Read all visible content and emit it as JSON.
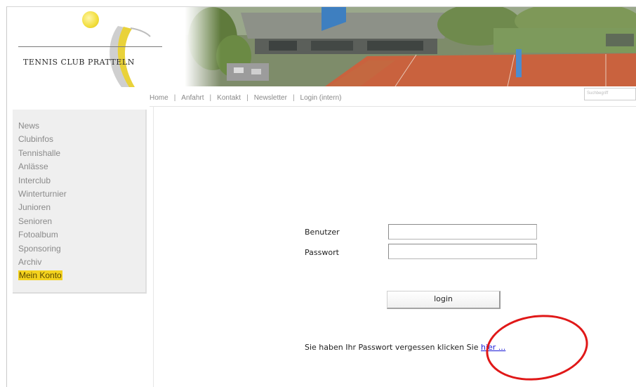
{
  "header": {
    "logo_text": "TENNIS CLUB PRATTELN"
  },
  "topnav": {
    "items": [
      {
        "label": "Home"
      },
      {
        "label": "Anfahrt"
      },
      {
        "label": "Kontakt"
      },
      {
        "label": "Newsletter"
      },
      {
        "label": "Login (intern)"
      }
    ],
    "search_placeholder": "Suchbegriff"
  },
  "sidebar": {
    "items": [
      {
        "label": "News"
      },
      {
        "label": "Clubinfos"
      },
      {
        "label": "Tennishalle"
      },
      {
        "label": "Anlässe"
      },
      {
        "label": "Interclub"
      },
      {
        "label": "Winterturnier"
      },
      {
        "label": "Junioren"
      },
      {
        "label": "Senioren"
      },
      {
        "label": "Fotoalbum"
      },
      {
        "label": "Sponsoring"
      },
      {
        "label": "Archiv"
      },
      {
        "label": "Mein Konto"
      }
    ],
    "active_color": "#f4d21e"
  },
  "login": {
    "username_label": "Benutzer",
    "password_label": "Passwort",
    "username_value": "",
    "password_value": "",
    "button_label": "login",
    "forgot_text": "Sie haben Ihr Passwort vergessen klicken Sie",
    "forgot_link": "hier ..."
  },
  "colors": {
    "annotation": "#e01818",
    "link": "#1a1ad6",
    "court": "#c9623e"
  }
}
